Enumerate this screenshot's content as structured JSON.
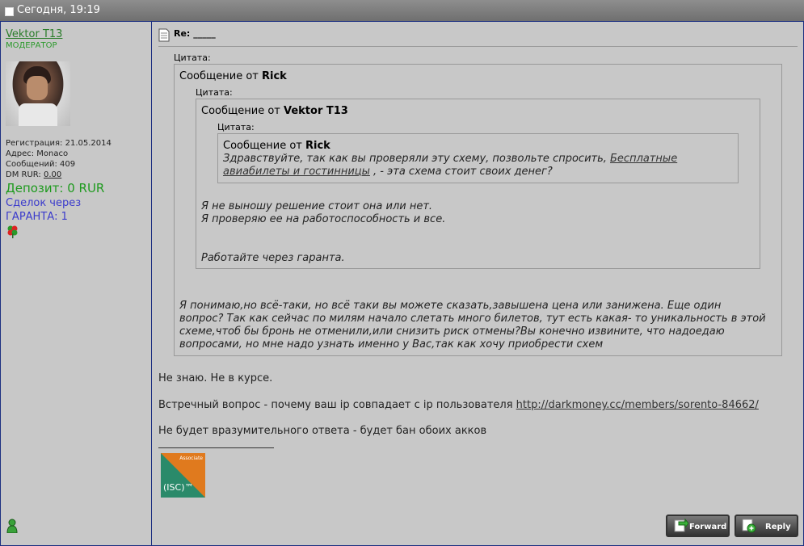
{
  "header": {
    "date": "Сегодня, 19:19"
  },
  "user": {
    "name": "Vektor T13",
    "role": "МОДЕРАТОР",
    "registration": "Регистрация: 21.05.2014",
    "address": "Адрес: Monaco",
    "posts": "Сообщений: 409",
    "dm_label": "DM RUR: ",
    "dm_value": "0.00",
    "deposit": "Депозит: 0 RUR",
    "deals_line1": "Сделок через",
    "deals_line2": "ГАРАНТА: 1"
  },
  "post": {
    "title_prefix": "Re:",
    "title": "_____",
    "quote_label": "Цитата:",
    "quote1": {
      "from_prefix": "Сообщение от ",
      "author": "Rick",
      "quote2": {
        "from_prefix": "Сообщение от ",
        "author": "Vektor T13",
        "quote3": {
          "from_prefix": "Сообщение от ",
          "author": "Rick",
          "text_line1_before": "Здравствуйте, так как вы проверяли эту схему, позвольте спросить, ",
          "link1": "Бесплатные",
          "link2": "авиабилеты и гостинницы",
          "text_line2_after": " , - эта схема стоит своих денег?"
        },
        "line1": "Я не выношу решение стоит она или нет.",
        "line2": "Я проверяю ее на работоспособность и все.",
        "line3": "Работайте через гаранта."
      },
      "line1": "Я понимаю,но всё-таки, но всё таки вы можете сказать,завышена цена или занижена. Еще один",
      "line2": "вопрос? Так как сейчас по милям начало слетать много билетов, тут есть какая- то уникальность в этой",
      "line3": "схеме,чтоб бы бронь не отменили,или снизить риск отмены?Вы конечно извините, что надоедаю",
      "line4": "вопросами, но мне надо узнать именно у Вас,так как хочу приобрести схем"
    },
    "reply1": "Не знаю. Не в курсе.",
    "reply2_text": "Встречный вопрос - почему ваш ip совпадает с ip пользователя ",
    "reply2_link": "http://darkmoney.cc/members/sorento-84662/",
    "reply3": "Не будет вразумительного ответа - будет бан обоих акков",
    "badge_top": "Associate",
    "badge_main": "(ISC)™"
  },
  "buttons": {
    "forward": "Forward",
    "reply": "Reply"
  },
  "colors": {
    "frame": "#1c2f80",
    "username": "#2b7d2b",
    "deposit": "#1e9a1e",
    "deals": "#3a3acc"
  }
}
